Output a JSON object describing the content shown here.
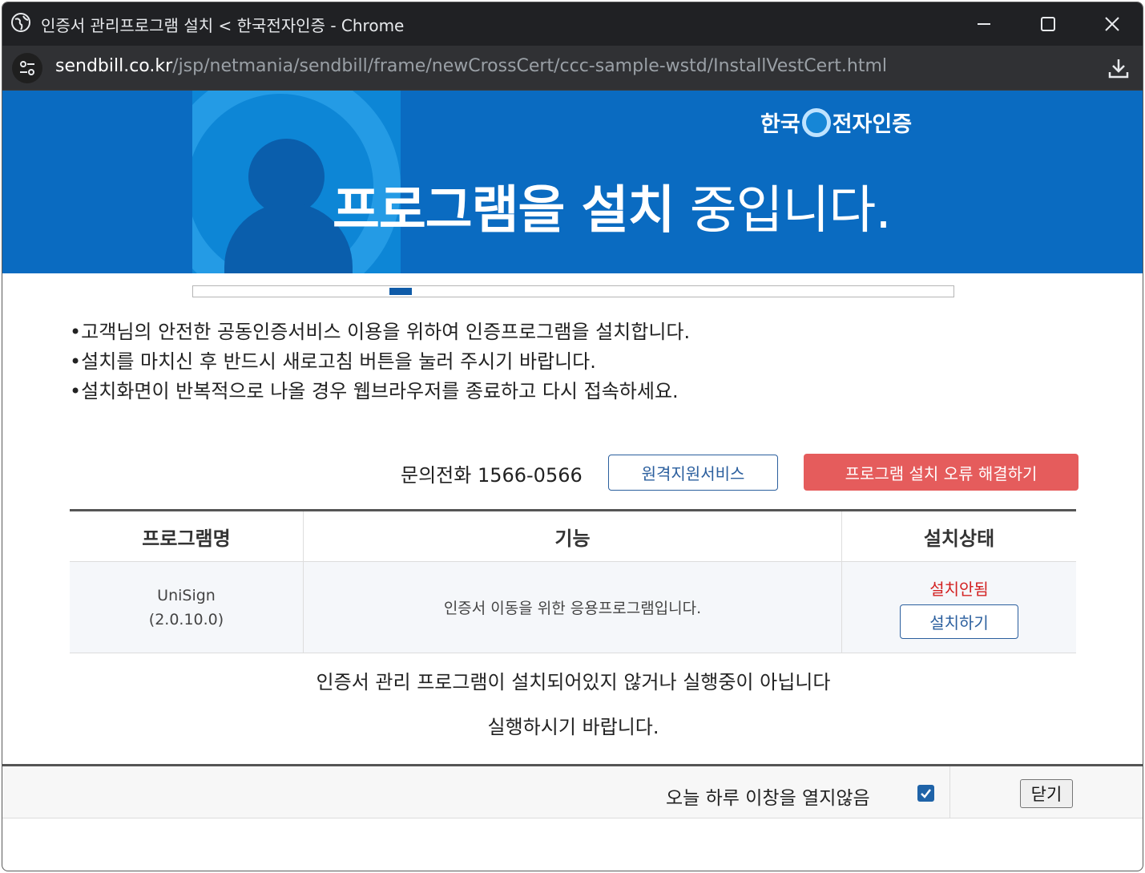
{
  "window": {
    "title": "인증서 관리프로그램 설치 < 한국전자인증 - Chrome",
    "controls": {
      "minimize": "minimize-icon",
      "maximize": "maximize-icon",
      "close": "close-icon"
    }
  },
  "address_bar": {
    "host": "sendbill.co.kr",
    "path": "/jsp/netmania/sendbill/frame/newCrossCert/ccc-sample-wstd/InstallVestCert.html",
    "site_info_icon": "tune-icon",
    "download_icon": "download-icon"
  },
  "banner": {
    "logo_text_left": "한국",
    "logo_text_right": "전자인증",
    "title_strong": "프로그램을 설치",
    "title_rest": " 중입니다.",
    "colors": {
      "background": "#0a6bc1",
      "art": "#0d86d6"
    }
  },
  "progress": {
    "fill_fraction_start": 0.258,
    "fill_fraction_width": 0.029
  },
  "notices": [
    "•고객님의 안전한 공동인증서비스 이용을 위하여 인증프로그램을 설치합니다.",
    "•설치를 마치신 후 반드시 새로고침 버튼을 눌러 주시기 바랍니다.",
    "•설치화면이 반복적으로 나올 경우 웹브라우저를 종료하고 다시 접속하세요."
  ],
  "contact": {
    "phone_label": "문의전화 1566-0566",
    "remote_button": "원격지원서비스",
    "fix_button": "프로그램 설치 오류 해결하기"
  },
  "table": {
    "headers": [
      "프로그램명",
      "기능",
      "설치상태"
    ],
    "rows": [
      {
        "name": "UniSign",
        "version": "(2.0.10.0)",
        "function": "인증서 이동을 위한 응용프로그램입니다.",
        "status": "설치안됨",
        "action": "설치하기"
      }
    ]
  },
  "messages": {
    "line1": "인증서 관리 프로그램이 설치되어있지 않거나 실행중이 아닙니다",
    "line2": "실행하시기 바랍니다."
  },
  "footer": {
    "dont_open_today": "오늘 하루 이창을 열지않음",
    "checkbox_checked": true,
    "close_button": "닫기"
  },
  "colors": {
    "fix_button": "#e55c5c",
    "status_error": "#d32222",
    "accent": "#2b5f9e"
  }
}
